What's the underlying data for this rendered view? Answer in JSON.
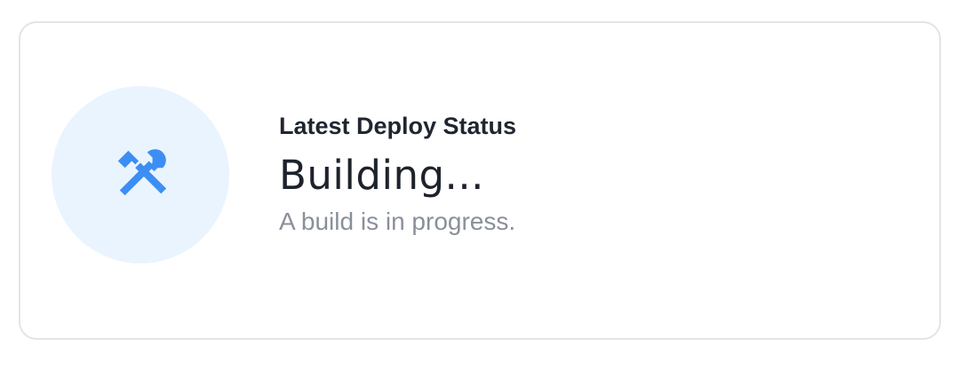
{
  "deploy_status": {
    "heading": "Latest Deploy Status",
    "status": "Building...",
    "description": "A build is in progress.",
    "icon": "hammer-wrench-icon",
    "colors": {
      "accent": "#3d8ef3",
      "icon_background": "#eaf4fe",
      "border": "#e3e4e7",
      "heading": "#1f2630",
      "status": "#1d222b",
      "description": "#8a9099"
    }
  }
}
